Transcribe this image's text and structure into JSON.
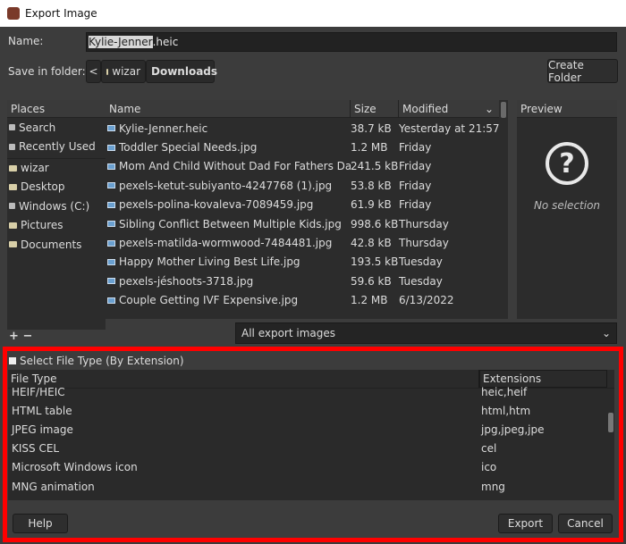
{
  "window": {
    "title": "Export Image"
  },
  "name": {
    "label": "Name:",
    "selected": "Kylie-Jenner",
    "rest": ".heic"
  },
  "folder": {
    "label": "Save in folder:",
    "back": "<",
    "crumbs": [
      "wizar",
      "Downloads"
    ],
    "create_folder": "Create Folder"
  },
  "places": {
    "header": "Places",
    "items": [
      {
        "label": "Search",
        "icon": "search-icon"
      },
      {
        "label": "Recently Used",
        "icon": "recent-icon"
      },
      {
        "label": "wizar",
        "icon": "folder-icon"
      },
      {
        "label": "Desktop",
        "icon": "folder-icon"
      },
      {
        "label": "Windows (C:)",
        "icon": "drive-icon"
      },
      {
        "label": "Pictures",
        "icon": "folder-icon"
      },
      {
        "label": "Documents",
        "icon": "folder-icon"
      }
    ],
    "add": "+",
    "remove": "−"
  },
  "files": {
    "headers": {
      "name": "Name",
      "size": "Size",
      "modified": "Modified"
    },
    "rows": [
      {
        "name": "Kylie-Jenner.heic",
        "size": "38.7 kB",
        "modified": "Yesterday at 21:57"
      },
      {
        "name": "Toddler Special Needs.jpg",
        "size": "1.2 MB",
        "modified": "Friday"
      },
      {
        "name": "Mom And Child Without Dad For Fathers Day...",
        "size": "241.5 kB",
        "modified": "Friday"
      },
      {
        "name": "pexels-ketut-subiyanto-4247768 (1).jpg",
        "size": "53.8 kB",
        "modified": "Friday"
      },
      {
        "name": "pexels-polina-kovaleva-7089459.jpg",
        "size": "61.9 kB",
        "modified": "Friday"
      },
      {
        "name": "Sibling Conflict Between Multiple Kids.jpg",
        "size": "998.6 kB",
        "modified": "Thursday"
      },
      {
        "name": "pexels-matilda-wormwood-7484481.jpg",
        "size": "42.8 kB",
        "modified": "Thursday"
      },
      {
        "name": "Happy Mother Living Best Life.jpg",
        "size": "193.5 kB",
        "modified": "Tuesday"
      },
      {
        "name": "pexels-jéshoots-3718.jpg",
        "size": "59.6 kB",
        "modified": "Tuesday"
      },
      {
        "name": "Couple Getting IVF Expensive.jpg",
        "size": "1.2 MB",
        "modified": "6/13/2022"
      }
    ]
  },
  "preview": {
    "header": "Preview",
    "empty": "No selection"
  },
  "filter": {
    "value": "All export images"
  },
  "filetype": {
    "toggle": "Select File Type (By Extension)",
    "headers": {
      "type": "File Type",
      "ext": "Extensions"
    },
    "rows": [
      {
        "type": "HEIF/HEIC",
        "ext": "heic,heif"
      },
      {
        "type": "HTML table",
        "ext": "html,htm"
      },
      {
        "type": "JPEG image",
        "ext": "jpg,jpeg,jpe"
      },
      {
        "type": "KISS CEL",
        "ext": "cel"
      },
      {
        "type": "Microsoft Windows icon",
        "ext": "ico"
      },
      {
        "type": "MNG animation",
        "ext": "mng"
      }
    ]
  },
  "buttons": {
    "help": "Help",
    "export": "Export",
    "cancel": "Cancel"
  },
  "colors": {
    "highlight": "#ff0000"
  }
}
